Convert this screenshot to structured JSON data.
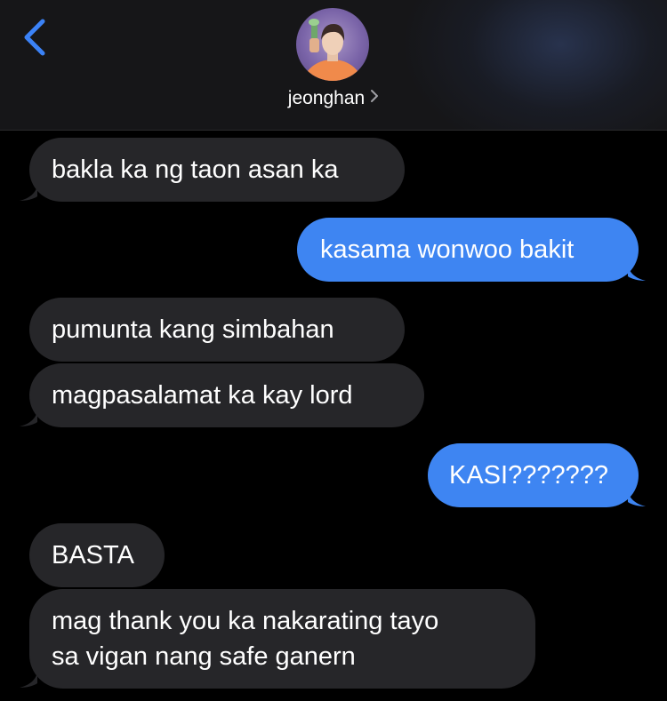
{
  "header": {
    "back_label": "Back",
    "contact_name": "jeonghan"
  },
  "colors": {
    "background": "#000000",
    "header_bg": "#161618",
    "incoming_bubble": "#262629",
    "outgoing_bubble": "#3e85f2",
    "accent": "#3b82f6",
    "text": "#ffffff"
  },
  "icons": {
    "back": "chevron-left-icon",
    "name_disclosure": "chevron-right-icon"
  },
  "messages": [
    {
      "direction": "incoming",
      "lines": [
        "bakla ka ng taon asan ka"
      ]
    },
    {
      "direction": "outgoing",
      "lines": [
        "kasama wonwoo bakit"
      ]
    },
    {
      "direction": "incoming",
      "lines": [
        "pumunta kang simbahan"
      ]
    },
    {
      "direction": "incoming",
      "lines": [
        "magpasalamat ka kay lord"
      ]
    },
    {
      "direction": "outgoing",
      "lines": [
        "KASI???????"
      ]
    },
    {
      "direction": "incoming",
      "lines": [
        "BASTA"
      ]
    },
    {
      "direction": "incoming",
      "lines": [
        "mag thank you ka nakarating tayo",
        "sa vigan nang safe ganern"
      ]
    }
  ]
}
